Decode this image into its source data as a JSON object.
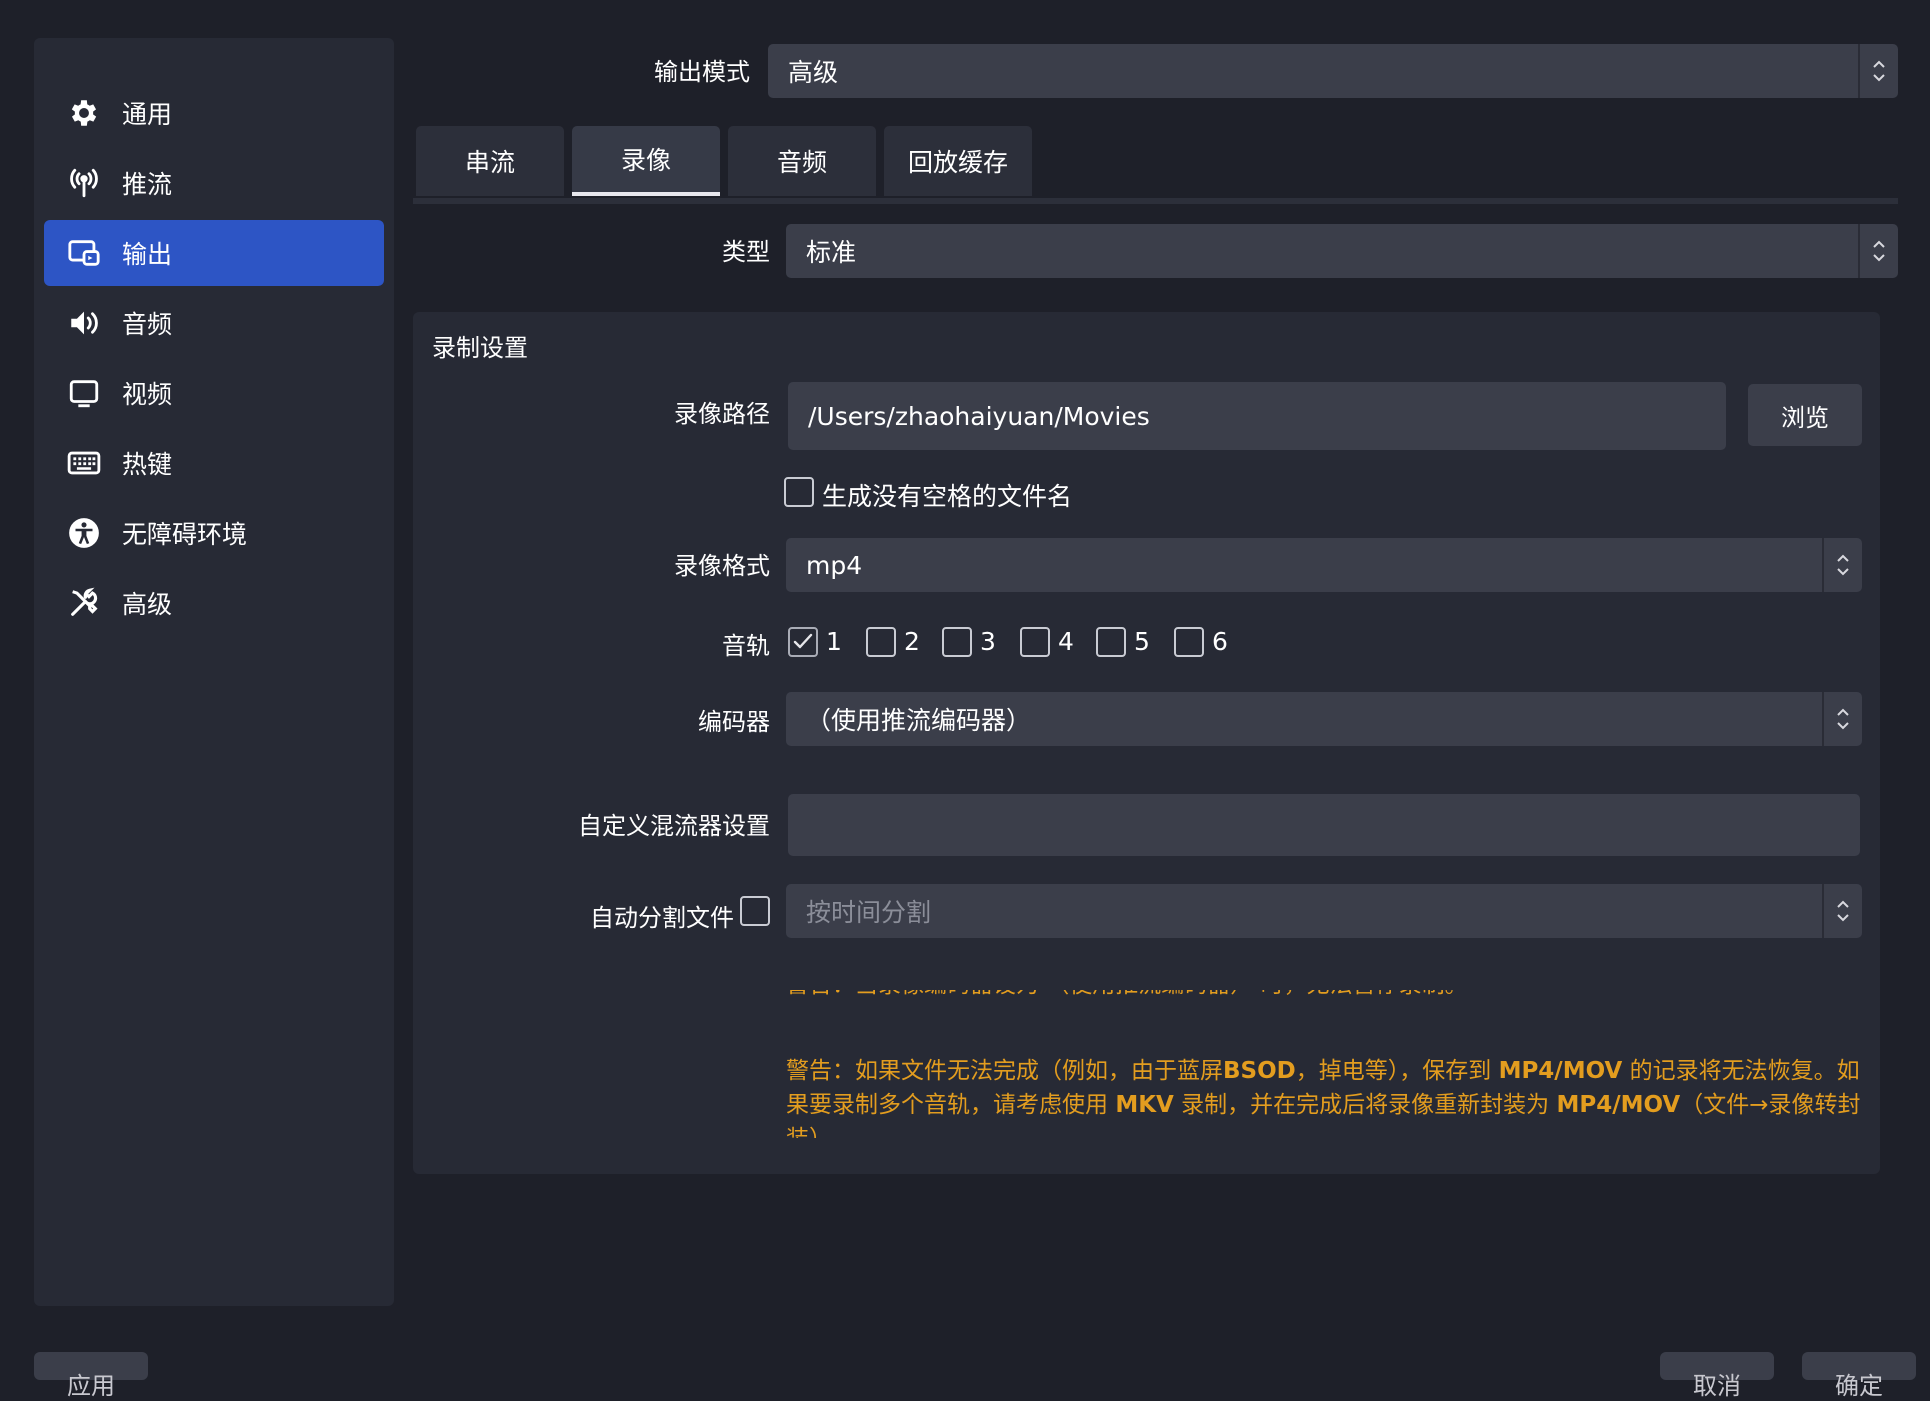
{
  "sidebar": {
    "items": [
      {
        "label": "通用",
        "icon": "gear-icon"
      },
      {
        "label": "推流",
        "icon": "antenna-icon"
      },
      {
        "label": "输出",
        "icon": "output-icon"
      },
      {
        "label": "音频",
        "icon": "speaker-icon"
      },
      {
        "label": "视频",
        "icon": "monitor-icon"
      },
      {
        "label": "热键",
        "icon": "keyboard-icon"
      },
      {
        "label": "无障碍环境",
        "icon": "accessibility-icon"
      },
      {
        "label": "高级",
        "icon": "tools-icon"
      }
    ],
    "active_index": 2
  },
  "output_mode": {
    "label": "输出模式",
    "value": "高级"
  },
  "tabs": [
    {
      "label": "串流"
    },
    {
      "label": "录像"
    },
    {
      "label": "音频"
    },
    {
      "label": "回放缓存"
    }
  ],
  "active_tab": 1,
  "type_field": {
    "label": "类型",
    "value": "标准"
  },
  "recording": {
    "group_title": "录制设置",
    "path_label": "录像路径",
    "path_value": "/Users/zhaohaiyuan/Movies",
    "browse_label": "浏览",
    "no_space_label": "生成没有空格的文件名",
    "no_space_checked": false,
    "format_label": "录像格式",
    "format_value": "mp4",
    "tracks_label": "音轨",
    "tracks": [
      {
        "label": "1",
        "checked": true
      },
      {
        "label": "2",
        "checked": false
      },
      {
        "label": "3",
        "checked": false
      },
      {
        "label": "4",
        "checked": false
      },
      {
        "label": "5",
        "checked": false
      },
      {
        "label": "6",
        "checked": false
      }
    ],
    "encoder_label": "编码器",
    "encoder_value": "（使用推流编码器）",
    "muxer_label": "自定义混流器设置",
    "muxer_value": "",
    "split_label": "自动分割文件",
    "split_checked": false,
    "split_value": "按时间分割"
  },
  "warnings": {
    "pause_warning": "警告：当录像编码器设为 （使用推流编码器） 时，无法暂停录制。",
    "file_warning_parts": [
      {
        "text": "警告：如果文件无法完成（例如，由于蓝屏",
        "bold": false
      },
      {
        "text": "BSOD",
        "bold": true
      },
      {
        "text": "，掉电等），保存到 ",
        "bold": false
      },
      {
        "text": "MP4/MOV",
        "bold": true
      },
      {
        "text": " 的记录将无法恢复。如果要录制多个音轨，请考虑使用 ",
        "bold": false
      },
      {
        "text": "MKV",
        "bold": true
      },
      {
        "text": " 录制，并在完成后将录像重新封装为 ",
        "bold": false
      },
      {
        "text": "MP4/MOV",
        "bold": true
      },
      {
        "text": "（文件→录像转封装）",
        "bold": false
      }
    ]
  },
  "footer": {
    "apply_label": "应用",
    "cancel_label": "取消",
    "ok_label": "确定"
  },
  "colors": {
    "background": "#1e2029",
    "panel": "#272a35",
    "field": "#3b3e4a",
    "accent": "#2d55c5",
    "warning": "#e39d1f"
  }
}
